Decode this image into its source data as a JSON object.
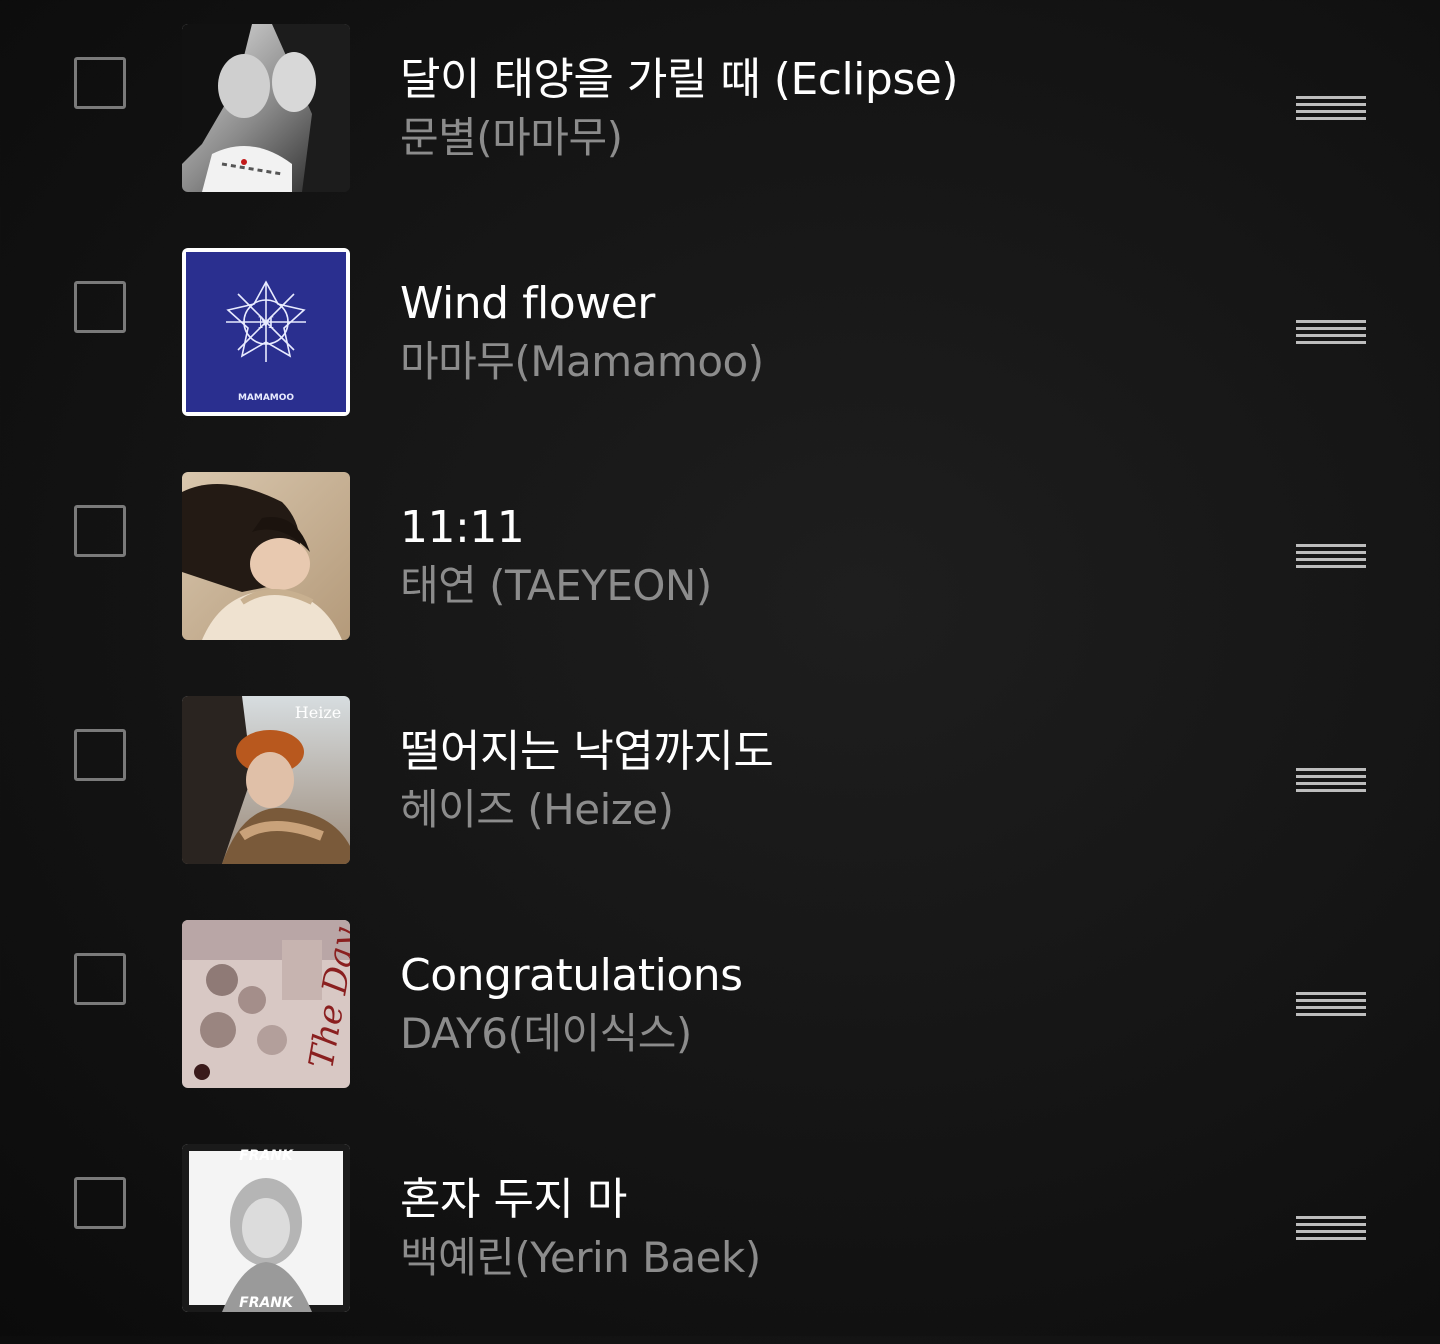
{
  "tracks": [
    {
      "title": "달이 태양을 가릴 때 (Eclipse)",
      "artist": "문별(마마무)",
      "art_icon": "album-art-eclipse",
      "checked": false
    },
    {
      "title": "Wind flower",
      "artist": "마마무(Mamamoo)",
      "art_icon": "album-art-wind-flower",
      "art_text": "MAMAMOO",
      "checked": false
    },
    {
      "title": "11:11",
      "artist": "태연 (TAEYEON)",
      "art_icon": "album-art-1111",
      "checked": false
    },
    {
      "title": "떨어지는 낙엽까지도",
      "artist": "헤이즈 (Heize)",
      "art_icon": "album-art-heize",
      "art_text": "Heize",
      "checked": false
    },
    {
      "title": "Congratulations",
      "artist": "DAY6(데이식스)",
      "art_icon": "album-art-the-day",
      "art_text": "The Day",
      "checked": false
    },
    {
      "title": "혼자 두지 마",
      "artist": "백예린(Yerin Baek)",
      "art_icon": "album-art-frank",
      "art_text": "FRANK",
      "checked": false
    }
  ],
  "colors": {
    "background": "#141414",
    "title": "#ffffff",
    "artist": "#8c8c8c",
    "checkbox_border": "#7a7a7a",
    "handle": "#bdbdbd"
  }
}
